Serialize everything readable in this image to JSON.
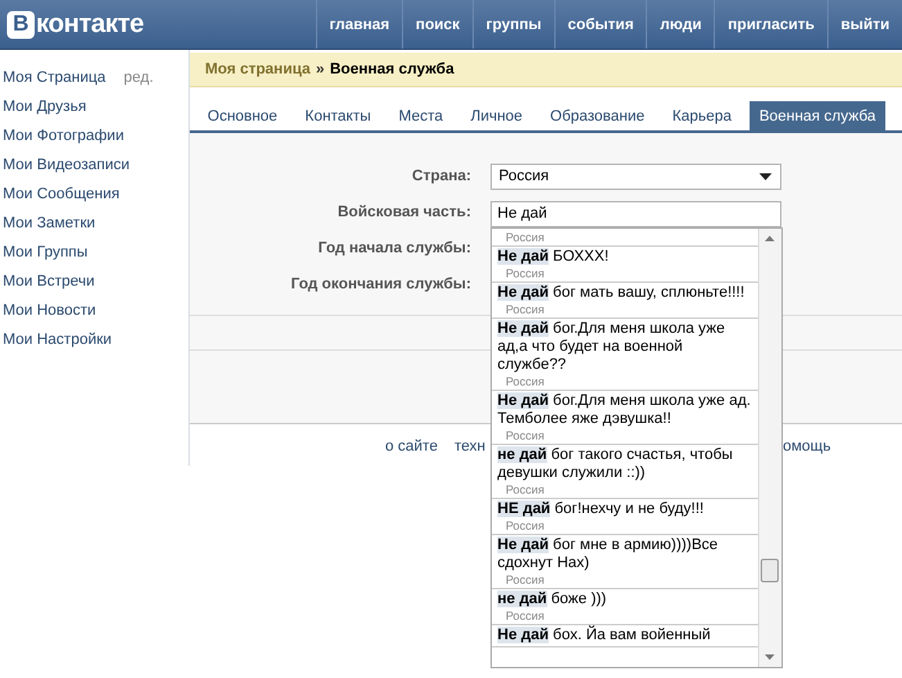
{
  "header": {
    "logo_letter": "В",
    "logo_text": "контакте",
    "nav": [
      "главная",
      "поиск",
      "группы",
      "события",
      "люди",
      "пригласить",
      "выйти"
    ]
  },
  "sidebar": {
    "items": [
      {
        "label": "Моя Страница",
        "extra": "ред."
      },
      {
        "label": "Мои Друзья"
      },
      {
        "label": "Мои Фотографии"
      },
      {
        "label": "Мои Видеозаписи"
      },
      {
        "label": "Мои Сообщения"
      },
      {
        "label": "Мои Заметки"
      },
      {
        "label": "Мои Группы"
      },
      {
        "label": "Мои Встречи"
      },
      {
        "label": "Мои Новости"
      },
      {
        "label": "Мои Настройки"
      }
    ]
  },
  "breadcrumb": {
    "parent": "Моя страница",
    "separator": "»",
    "current": "Военная служба"
  },
  "tabs": [
    {
      "label": "Основное",
      "selected": false
    },
    {
      "label": "Контакты",
      "selected": false
    },
    {
      "label": "Места",
      "selected": false
    },
    {
      "label": "Личное",
      "selected": false
    },
    {
      "label": "Образование",
      "selected": false
    },
    {
      "label": "Карьера",
      "selected": false
    },
    {
      "label": "Военная служба",
      "selected": true
    }
  ],
  "form": {
    "fields": [
      {
        "label": "Страна:",
        "kind": "select",
        "value": "Россия"
      },
      {
        "label": "Войсковая часть:",
        "kind": "input",
        "value": "Не дай"
      },
      {
        "label": "Год начала службы:",
        "kind": "empty"
      },
      {
        "label": "Год окончания службы:",
        "kind": "empty"
      }
    ]
  },
  "suggestions": [
    {
      "country": "Россия"
    },
    {
      "match": "Не дай",
      "text": "БОХХХ!",
      "country": "Россия"
    },
    {
      "match": "Не дай",
      "text": "бог мать вашу, сплюньте!!!!",
      "country": "Россия"
    },
    {
      "match": "Не дай",
      "text": "бог.Для меня школа уже ад,а что будет на военной службе??",
      "country": "Россия"
    },
    {
      "match": "Не дай",
      "text": "бог.Для меня школа уже ад. Темболее яже дэвушка!!",
      "country": "Россия"
    },
    {
      "match": "не дай",
      "text": "бог такого счастья, чтобы девушки служили ::))",
      "country": "Россия"
    },
    {
      "match": "НЕ дай",
      "text": "бог!нехчу и не буду!!!",
      "country": "Россия"
    },
    {
      "match": "Не дай",
      "text": "бог мне в армию))))Все сдохнут Нах)",
      "country": "Россия"
    },
    {
      "match": "не дай",
      "text": "боже )))",
      "country": "Россия"
    },
    {
      "match": "Не дай",
      "text": "бох. Йа вам войенный"
    }
  ],
  "footer": {
    "links": [
      "о сайте",
      "техн",
      "омощь"
    ]
  }
}
